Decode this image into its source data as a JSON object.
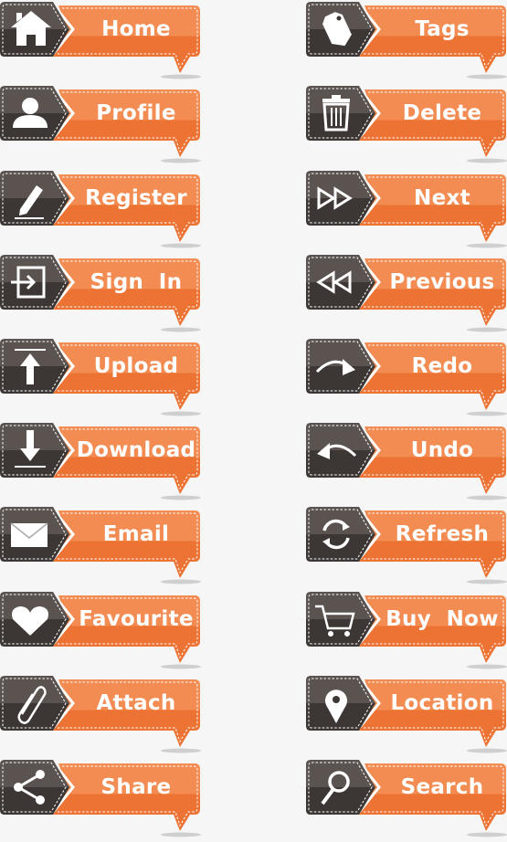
{
  "colors": {
    "orange_top": "#f28c52",
    "orange_bottom": "#ec7333",
    "dark_top": "#5b5350",
    "dark_bottom": "#3c3734",
    "stitch": "#ffffff"
  },
  "buttons": [
    {
      "label": "Home",
      "icon": "home-icon",
      "col": 0
    },
    {
      "label": "Profile",
      "icon": "user-icon",
      "col": 0
    },
    {
      "label": "Register",
      "icon": "pencil-icon",
      "col": 0
    },
    {
      "label": "Sign  In",
      "icon": "sign-in-icon",
      "col": 0
    },
    {
      "label": "Upload",
      "icon": "upload-icon",
      "col": 0
    },
    {
      "label": "Download",
      "icon": "download-icon",
      "col": 0
    },
    {
      "label": "Email",
      "icon": "envelope-icon",
      "col": 0
    },
    {
      "label": "Favourite",
      "icon": "heart-icon",
      "col": 0
    },
    {
      "label": "Attach",
      "icon": "paperclip-icon",
      "col": 0
    },
    {
      "label": "Share",
      "icon": "share-icon",
      "col": 0
    },
    {
      "label": "Tags",
      "icon": "tag-icon",
      "col": 1
    },
    {
      "label": "Delete",
      "icon": "trash-icon",
      "col": 1
    },
    {
      "label": "Next",
      "icon": "fast-forward-icon",
      "col": 1
    },
    {
      "label": "Previous",
      "icon": "rewind-icon",
      "col": 1
    },
    {
      "label": "Redo",
      "icon": "redo-icon",
      "col": 1
    },
    {
      "label": "Undo",
      "icon": "undo-icon",
      "col": 1
    },
    {
      "label": "Refresh",
      "icon": "refresh-icon",
      "col": 1
    },
    {
      "label": "Buy  Now",
      "icon": "cart-icon",
      "col": 1
    },
    {
      "label": "Location",
      "icon": "location-pin-icon",
      "col": 1
    },
    {
      "label": "Search",
      "icon": "search-icon",
      "col": 1
    }
  ]
}
